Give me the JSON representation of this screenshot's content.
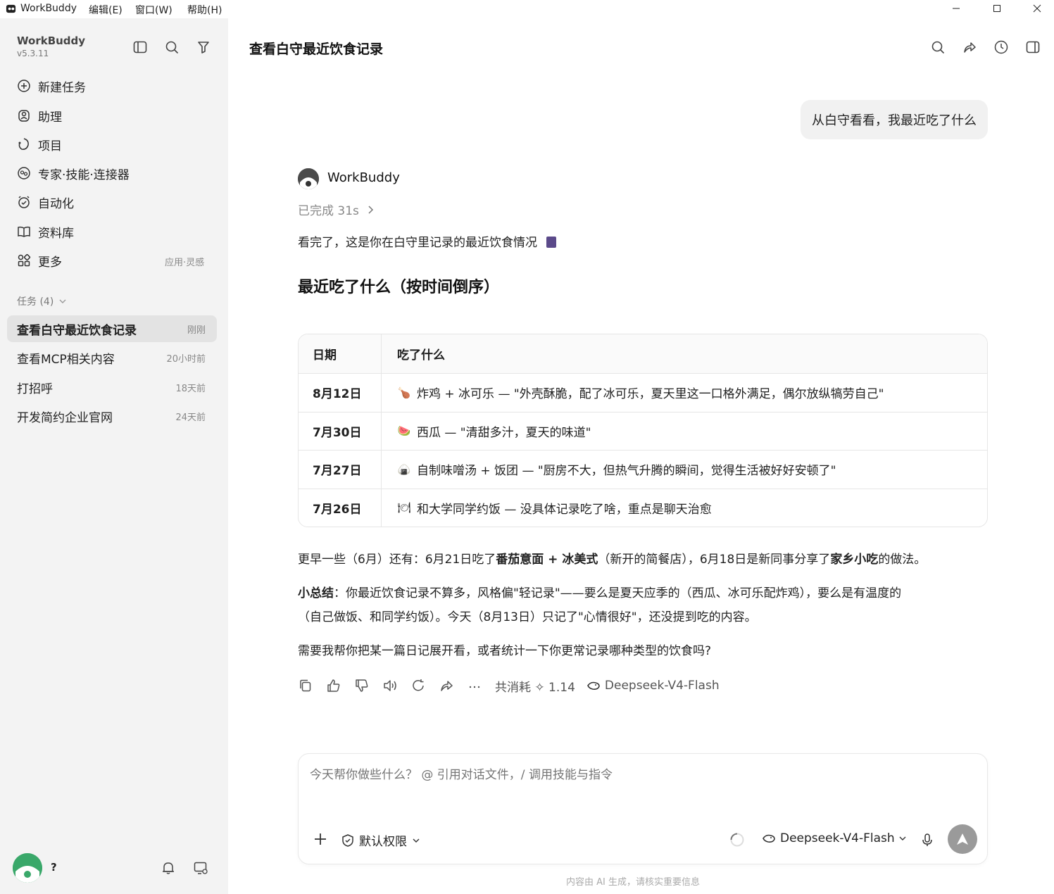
{
  "app": {
    "title": "WorkBuddy"
  },
  "menu": [
    "编辑(E)",
    "窗口(W)",
    "帮助(H)"
  ],
  "sidebar": {
    "brand": "WorkBuddy",
    "version": "v5.3.11",
    "nav": [
      {
        "label": "新建任务",
        "icon": "new-task-icon"
      },
      {
        "label": "助理",
        "icon": "assistant-icon"
      },
      {
        "label": "项目",
        "icon": "project-icon"
      },
      {
        "label": "专家·技能·连接器",
        "icon": "expert-icon"
      },
      {
        "label": "自动化",
        "icon": "alarm-icon"
      },
      {
        "label": "资料库",
        "icon": "book-icon"
      },
      {
        "label": "更多",
        "icon": "grid-icon"
      }
    ],
    "more_extra": "应用·灵感",
    "tasks_title": "任务 (4)",
    "tasks": [
      {
        "label": "查看白守最近饮食记录",
        "time": "刚刚"
      },
      {
        "label": "查看MCP相关内容",
        "time": "20小时前"
      },
      {
        "label": "打招呼",
        "time": "18天前"
      },
      {
        "label": "开发简约企业官网",
        "time": "24天前"
      }
    ],
    "user_name": "?"
  },
  "main": {
    "title": "查看白守最近饮食记录",
    "user_message": "从白守看看，我最近吃了什么",
    "bot_name": "WorkBuddy",
    "status": "已完成 31s",
    "intro": "看完了，这是你在白守里记录的最近饮食情况",
    "heading": "最近吃了什么（按时间倒序）",
    "table": {
      "headers": [
        "日期",
        "吃了什么"
      ],
      "rows": [
        {
          "date": "8月12日",
          "emoji": "🍗",
          "text": "炸鸡 + 冰可乐 — \"外壳酥脆，配了冰可乐，夏天里这一口格外满足，偶尔放纵犒劳自己\""
        },
        {
          "date": "7月30日",
          "emoji": "🍉",
          "text": "西瓜 — \"清甜多汁，夏天的味道\""
        },
        {
          "date": "7月27日",
          "emoji": "🍙",
          "text": "自制味噌汤 + 饭团 — \"厨房不大，但热气升腾的瞬间，觉得生活被好好安顿了\""
        },
        {
          "date": "7月26日",
          "emoji": "🍽",
          "text": "和大学同学约饭 — 没具体记录吃了啥，重点是聊天治愈"
        }
      ]
    },
    "earlier": {
      "p1": "更早一些（6月）还有：6月21日吃了",
      "b1": "番茄意面 + 冰美式",
      "p2": "（新开的简餐店），6月18日是新同事分享了",
      "b2": "家乡小吃",
      "p3": "的做法。"
    },
    "summary": {
      "label": "小总结",
      "line1": "：你最近饮食记录不算多，风格偏\"轻记录\"——要么是夏天应季的（西瓜、冰可乐配炸鸡），要么是有温度的",
      "line2": "（自己做饭、和同学约饭）。今天（8月13日）只记了\"心情很好\"，还没提到吃的内容。"
    },
    "question": "需要我帮你把某一篇日记展开看，或者统计一下你更常记录哪种类型的饮食吗?",
    "usage": "共消耗 ✧ 1.14",
    "model_used": "Deepseek-V4-Flash"
  },
  "composer": {
    "placeholder": "今天帮你做些什么？ @ 引用对话文件，/ 调用技能与指令",
    "permission": "默认权限",
    "model": "Deepseek-V4-Flash",
    "disclaimer": "内容由 AI 生成，请核实重要信息"
  }
}
